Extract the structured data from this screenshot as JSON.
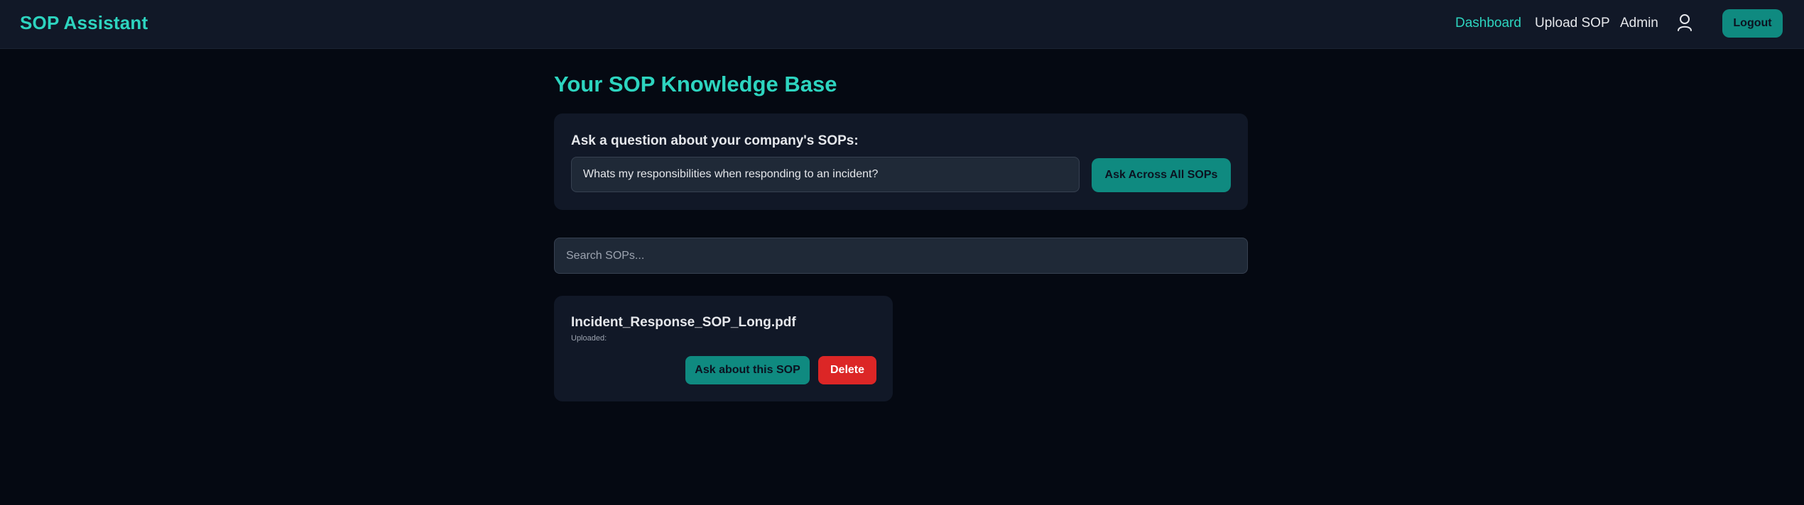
{
  "nav": {
    "brand": "SOP Assistant",
    "links": [
      {
        "label": "Dashboard",
        "active": true
      },
      {
        "label": "Upload SOP",
        "active": false
      },
      {
        "label": "Admin",
        "active": false
      }
    ],
    "user_icon": "user-icon",
    "logout_label": "Logout"
  },
  "main": {
    "title": "Your SOP Knowledge Base",
    "ask": {
      "label": "Ask a question about your company's SOPs:",
      "value": "Whats my responsibilities when responding to an incident?",
      "button_label": "Ask Across All SOPs"
    },
    "search": {
      "placeholder": "Search SOPs..."
    },
    "sops": [
      {
        "name": "Incident_Response_SOP_Long.pdf",
        "uploaded_label": "Uploaded:",
        "ask_label": "Ask about this SOP",
        "delete_label": "Delete"
      }
    ]
  },
  "colors": {
    "accent": "#2dd4bf",
    "button": "#0f8a80",
    "danger": "#dc2626",
    "background": "#050912",
    "card": "#111827"
  }
}
